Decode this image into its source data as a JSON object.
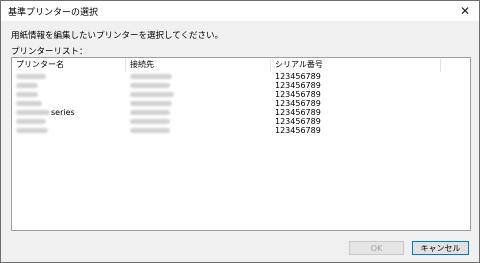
{
  "window": {
    "title": "基準プリンターの選択",
    "close_glyph": "✕"
  },
  "instruction": "用紙情報を編集したいプリンターを選択してください。",
  "list_label": "プリンターリスト：",
  "columns": {
    "name": "プリンター名",
    "connection": "接続先",
    "serial": "シリアル番号"
  },
  "rows": [
    {
      "name_suffix": "",
      "serial": "123456789"
    },
    {
      "name_suffix": "",
      "serial": "123456789"
    },
    {
      "name_suffix": "",
      "serial": "123456789"
    },
    {
      "name_suffix": "",
      "serial": "123456789"
    },
    {
      "name_suffix": "series",
      "serial": "123456789"
    },
    {
      "name_suffix": "",
      "serial": "123456789"
    },
    {
      "name_suffix": "",
      "serial": "123456789"
    }
  ],
  "buttons": {
    "ok": "OK",
    "cancel": "キャンセル"
  }
}
